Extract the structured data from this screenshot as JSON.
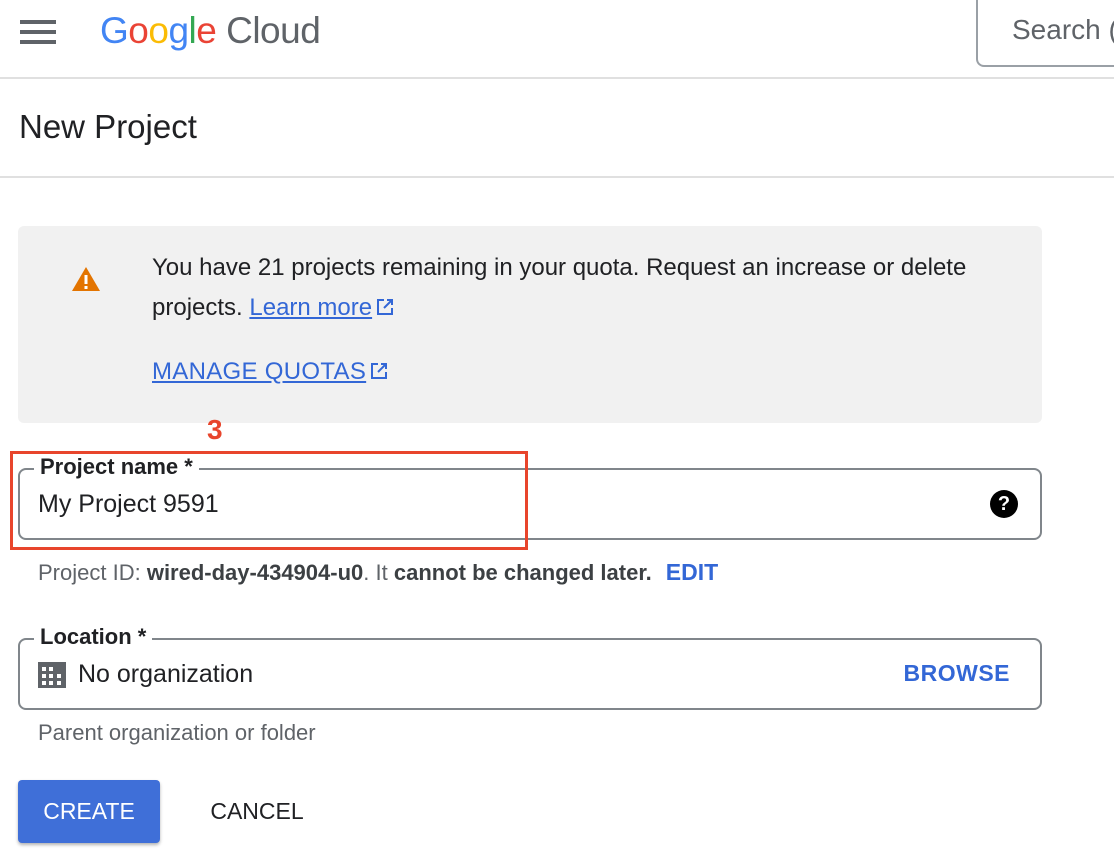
{
  "header": {
    "logo_google": "Google",
    "logo_cloud": "Cloud",
    "search_placeholder": "Search ("
  },
  "page": {
    "title": "New Project"
  },
  "banner": {
    "text": "You have 21 projects remaining in your quota. Request an increase or delete projects.",
    "learn_more": "Learn more",
    "manage_quotas": "MANAGE QUOTAS",
    "icon": "warning-icon",
    "icon_color": "#e37400"
  },
  "annotation": {
    "label": "3",
    "color": "#e8452c"
  },
  "project_name": {
    "label": "Project name *",
    "value": "My Project 9591",
    "help_icon": "help-icon"
  },
  "project_id": {
    "prefix": "Project ID:",
    "id": "wired-day-434904-u0",
    "suffix_plain": ". It",
    "suffix_bold": "cannot be changed later.",
    "edit": "EDIT"
  },
  "location": {
    "label": "Location *",
    "value": "No organization",
    "browse": "BROWSE",
    "hint": "Parent organization or folder"
  },
  "actions": {
    "create": "CREATE",
    "cancel": "CANCEL"
  },
  "colors": {
    "accent": "#3367d6",
    "primary_button": "#3f6fd8"
  }
}
